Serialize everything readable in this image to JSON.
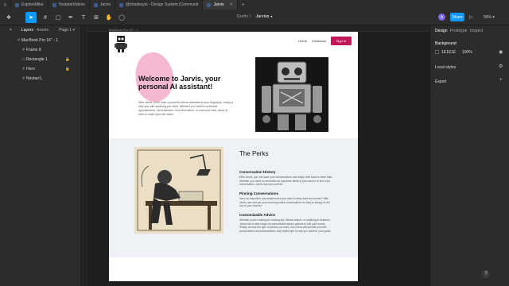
{
  "tabs": [
    {
      "label": "ExploreMike"
    },
    {
      "label": "YoutubeVideos"
    },
    {
      "label": "Jarvis"
    },
    {
      "label": "@shadesyui - Design System (Communit"
    },
    {
      "label": "Jarvis"
    }
  ],
  "toolbar": {
    "breadcrumb_folder": "Drafts",
    "breadcrumb_file": "Jarviss",
    "avatar_initial": "A",
    "share_label": "Share",
    "zoom_label": "50%"
  },
  "left_panel": {
    "tab_layers": "Layers",
    "tab_assets": "Assets",
    "page_label": "Page 1",
    "layers": [
      {
        "label": "MacBook Pro 16\" - 1",
        "locked": false
      },
      {
        "label": "Frame 8",
        "locked": false
      },
      {
        "label": "Rectangle 1",
        "locked": true
      },
      {
        "label": "Hero",
        "locked": true
      },
      {
        "label": "Navbar1,",
        "locked": false
      }
    ]
  },
  "right_panel": {
    "tab_design": "Design",
    "tab_prototype": "Prototype",
    "tab_inspect": "Inspect",
    "background_title": "Background",
    "background_hex": "1E1E1E",
    "background_opacity": "100%",
    "local_styles": "Local styles",
    "export": "Export"
  },
  "canvas": {
    "frame_label": "MacBook Pro 16\" - 1"
  },
  "page": {
    "nav_home": "Home",
    "nav_download": "Download",
    "nav_signin": "Sign in",
    "hero_title": "Welcome to Jarvis, your personal AI assistant!",
    "hero_body": "With Jarvis, you'll have a powerful virtual assistant at your fingertips, ready to help you with anything you need. Whether you need to schedule appointments, set reminders, find information, or even just chat, Jarvis is here to make your life easier.",
    "perks_title": "The Perks",
    "perks": [
      {
        "heading": "Conversation History",
        "body": "With Jarvis, you can save your conversations and easily refer back to them later. Whether you need to remember an important detail or just want to re-live a fun conversation, Jarvis has you covered."
      },
      {
        "heading": "Pinning Conversations",
        "body": "Have an important conversation that you want to keep front and center? With Jarvis, you can pin your most important conversations so they're always at the top of your chat list."
      },
      {
        "heading": "Customizable Advice",
        "body": "Whether you're looking for cooking tips, fitness advice, or anything in between, Jarvis has a wide range of customizable advice options to suit your needs. Simply choose the type of advice you want, and Jarvis will provide you with personalized recommendations and helpful tips to help you achieve your goals."
      }
    ]
  },
  "colors": {
    "accent": "#0d99ff",
    "signin": "#c2185b",
    "blob": "#f4b8d3",
    "perks_bg": "#eef1f6"
  }
}
